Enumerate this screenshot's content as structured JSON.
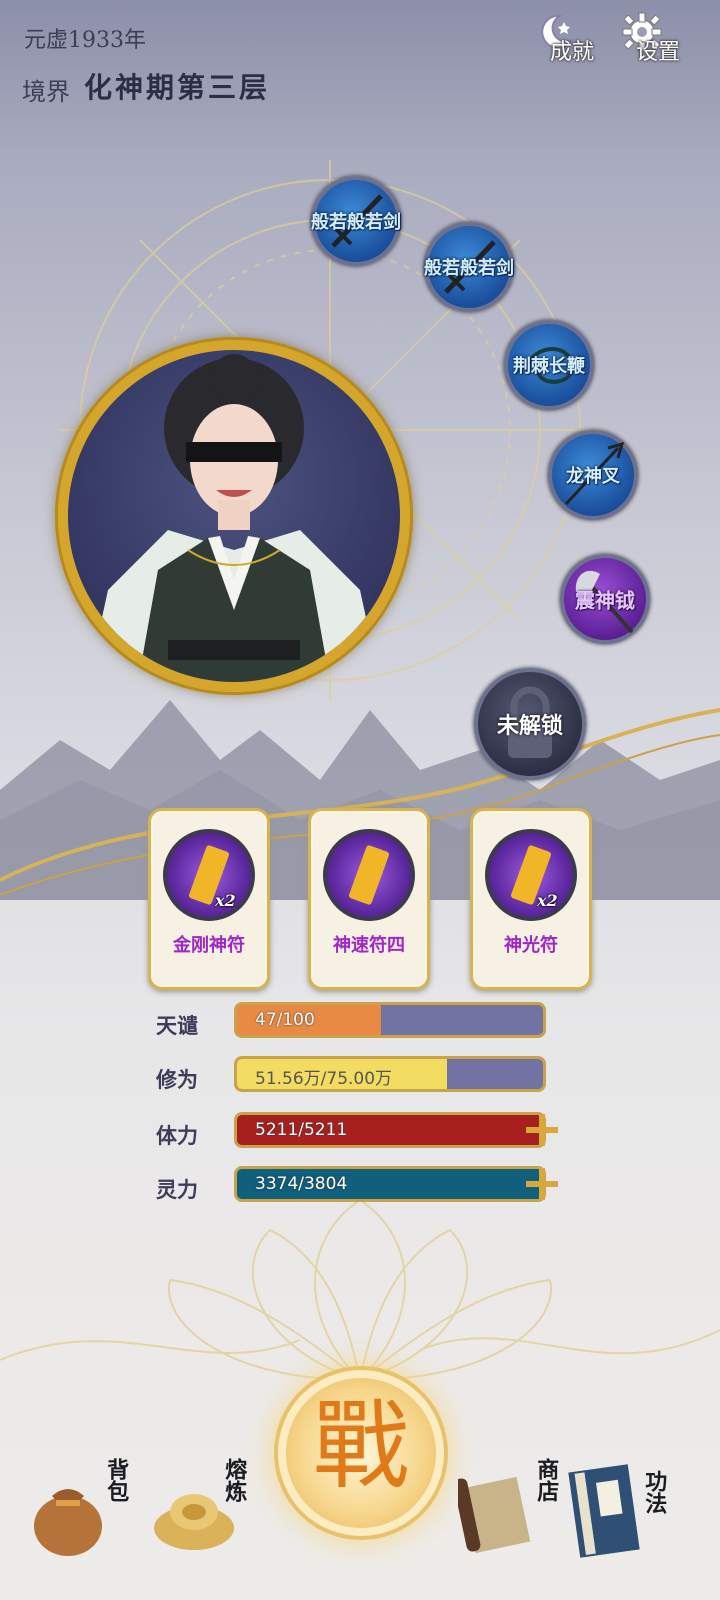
{
  "header": {
    "year_text": "元虚1933年",
    "realm_label": "境界",
    "realm_value": "化神期第三层"
  },
  "top_buttons": {
    "achievements": {
      "label": "成就",
      "icon": "moon-star-icon"
    },
    "settings": {
      "label": "设置",
      "icon": "gear-icon"
    }
  },
  "weapons": [
    {
      "name": "般若般若剑",
      "style": "blue",
      "icon": "sword-icon"
    },
    {
      "name": "般若般若剑",
      "style": "blue",
      "icon": "sword-icon"
    },
    {
      "name": "荆棘长鞭",
      "style": "blue",
      "icon": "whip-icon"
    },
    {
      "name": "龙神叉",
      "style": "blue",
      "icon": "trident-icon"
    },
    {
      "name": "震神钺",
      "style": "purple",
      "icon": "axe-icon"
    },
    {
      "name": "未解锁",
      "style": "locked",
      "icon": "lock-icon"
    }
  ],
  "talismans": [
    {
      "name": "金刚神符",
      "qty": "x2"
    },
    {
      "name": "神速符四",
      "qty": ""
    },
    {
      "name": "神光符",
      "qty": "x2"
    }
  ],
  "stats": [
    {
      "label": "天谴",
      "value": "47/100",
      "fraction": 0.47,
      "color": "#e88a44",
      "plus": false
    },
    {
      "label": "修为",
      "value": "51.56万/75.00万",
      "fraction": 0.6875,
      "color": "#f3dc62",
      "plus": false
    },
    {
      "label": "体力",
      "value": "5211/5211",
      "fraction": 1.0,
      "color": "#a8201e",
      "plus": true
    },
    {
      "label": "灵力",
      "value": "3374/3804",
      "fraction": 1.0,
      "color": "#0f5f7d",
      "plus": true
    }
  ],
  "fight_button": {
    "label": "戰"
  },
  "bottom_nav": [
    {
      "label": "背包",
      "icon": "pouch-icon"
    },
    {
      "label": "熔炼",
      "icon": "gold-ingot-icon"
    },
    {
      "label": "商店",
      "icon": "scroll-map-icon"
    },
    {
      "label": "功法",
      "icon": "book-icon"
    }
  ]
}
